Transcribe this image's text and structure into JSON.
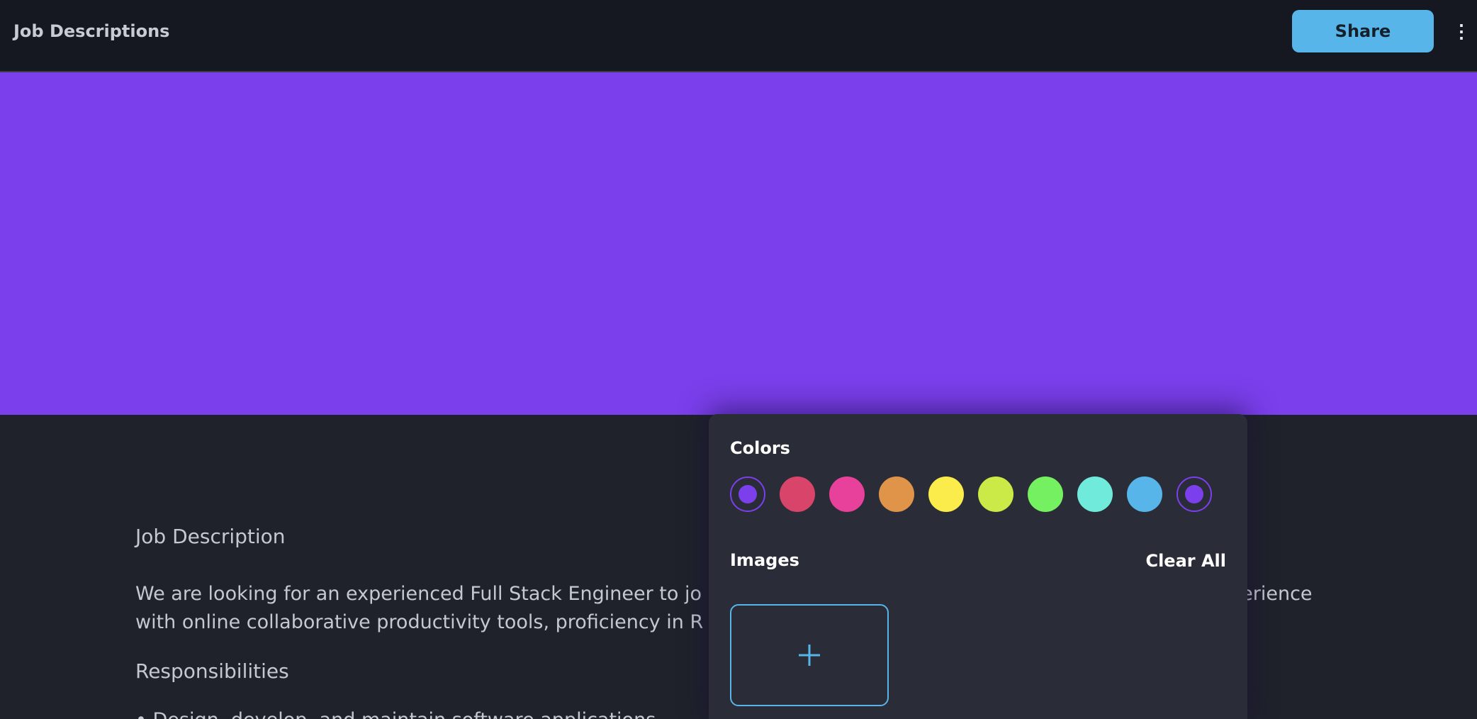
{
  "header": {
    "title": "Job Descriptions",
    "share_label": "Share",
    "more_icon": "vertical-ellipsis-icon",
    "more_glyph": "⋮"
  },
  "cover": {
    "color": "#7b3feb"
  },
  "content": {
    "heading": "Job Description",
    "paragraph": "We are looking for an experienced Full Stack Engineer to jo",
    "paragraph_tail": "perience",
    "paragraph_line2": "with online collaborative productivity tools, proficiency in R",
    "responsibilities_heading": "Responsibilities",
    "bullet_partial": "• Design, develop, and maintain software applications"
  },
  "popover": {
    "colors_label": "Colors",
    "images_label": "Images",
    "clear_all_label": "Clear All",
    "add_image_icon": "plus-icon",
    "colors": [
      {
        "name": "purple",
        "hex": "#7b3feb",
        "selected": true
      },
      {
        "name": "red",
        "hex": "#d9456a",
        "selected": false
      },
      {
        "name": "pink",
        "hex": "#e8419b",
        "selected": false
      },
      {
        "name": "orange",
        "hex": "#e0944a",
        "selected": false
      },
      {
        "name": "yellow",
        "hex": "#fbec4b",
        "selected": false
      },
      {
        "name": "lime",
        "hex": "#cbea47",
        "selected": false
      },
      {
        "name": "green",
        "hex": "#74f061",
        "selected": false
      },
      {
        "name": "teal",
        "hex": "#70ebdb",
        "selected": false
      },
      {
        "name": "blue",
        "hex": "#57b5ea",
        "selected": false
      },
      {
        "name": "violet",
        "hex": "#7b3feb",
        "selected": true
      }
    ]
  }
}
